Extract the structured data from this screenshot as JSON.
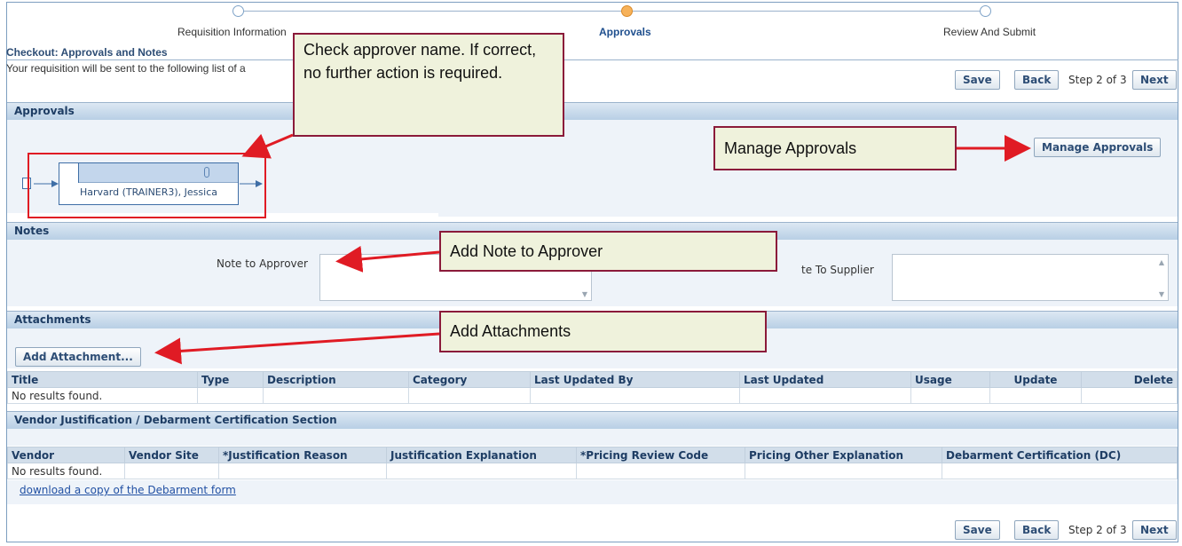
{
  "train": {
    "steps": [
      {
        "label": "Requisition Information",
        "active": false
      },
      {
        "label": "Approvals",
        "active": true
      },
      {
        "label": "Review And Submit",
        "active": false
      }
    ]
  },
  "header": {
    "title": "Checkout: Approvals and Notes",
    "instruction": "Your requisition will be sent to the following list of a"
  },
  "nav": {
    "save": "Save",
    "back": "Back",
    "step": "Step 2 of 3",
    "next": "Next"
  },
  "approvals": {
    "heading": "Approvals",
    "approver_name": "Harvard (TRAINER3), Jessica",
    "manage_button": "Manage Approvals"
  },
  "notes": {
    "heading": "Notes",
    "approver_label": "Note to Approver",
    "approver_value": "",
    "supplier_label": "te To Supplier",
    "supplier_value": ""
  },
  "attachments": {
    "heading": "Attachments",
    "add_button": "Add Attachment...",
    "columns": [
      "Title",
      "Type",
      "Description",
      "Category",
      "Last Updated By",
      "Last Updated",
      "Usage",
      "Update",
      "Delete"
    ],
    "empty": "No results found."
  },
  "vendor": {
    "heading": "Vendor Justification / Debarment Certification Section",
    "columns": [
      "Vendor",
      "Vendor Site",
      "*Justification Reason",
      "Justification Explanation",
      "*Pricing Review Code",
      "Pricing Other Explanation",
      "Debarment Certification (DC)"
    ],
    "empty": "No results found.",
    "download_link": "download a copy of the Debarment form"
  },
  "callouts": {
    "check_approver": "Check approver name. If correct, no further action is required.",
    "manage": "Manage Approvals",
    "note": "Add Note to Approver",
    "attach": "Add Attachments"
  },
  "colors": {
    "callout_border": "#8b1a3a",
    "arrow": "#e01b24",
    "section_header": "#b8cfe5"
  }
}
